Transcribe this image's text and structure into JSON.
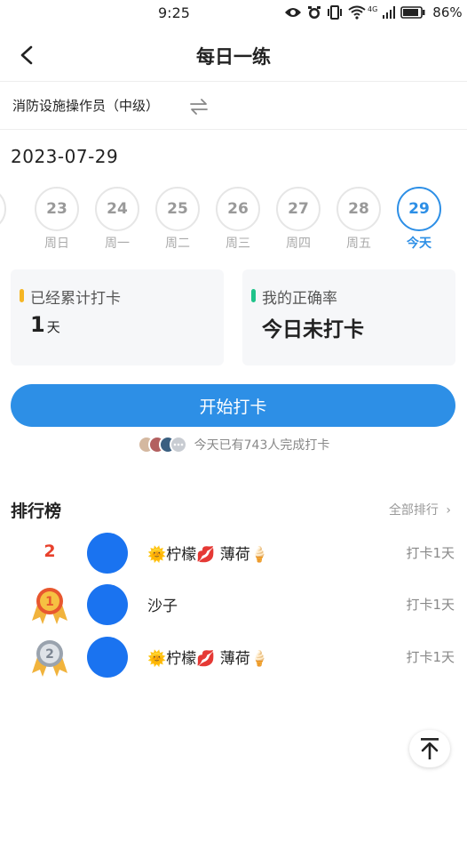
{
  "status": {
    "time": "9:25",
    "network": "4G",
    "battery": "86%"
  },
  "header": {
    "title": "每日一练"
  },
  "course": {
    "name": "消防设施操作员（中级）"
  },
  "date": "2023-07-29",
  "week": [
    {
      "num": "23",
      "label": "周日"
    },
    {
      "num": "24",
      "label": "周一"
    },
    {
      "num": "25",
      "label": "周二"
    },
    {
      "num": "26",
      "label": "周三"
    },
    {
      "num": "27",
      "label": "周四"
    },
    {
      "num": "28",
      "label": "周五"
    },
    {
      "num": "29",
      "label": "今天",
      "active": true
    }
  ],
  "stats": {
    "checkin_label": "已经累计打卡",
    "checkin_value": "1",
    "checkin_unit": "天",
    "accuracy_label": "我的正确率",
    "accuracy_value": "今日未打卡"
  },
  "start_button": "开始打卡",
  "completed_text": "今天已有743人完成打卡",
  "ranking": {
    "title": "排行榜",
    "all_label": "全部排行",
    "rows": [
      {
        "rank": "2",
        "medal": "",
        "name": "🌞柠檬💋 薄荷🍦",
        "days": "打卡1天"
      },
      {
        "rank": "1",
        "medal": "gold-medal-icon",
        "name": "沙子",
        "days": "打卡1天"
      },
      {
        "rank": "2",
        "medal": "silver-medal-icon",
        "name": "🌞柠檬💋 薄荷🍦",
        "days": "打卡1天"
      }
    ]
  },
  "colors": {
    "accent": "#2d8fe6",
    "avatar": "#1a73f0",
    "rank_red": "#e8412c",
    "bar_yellow": "#f5b625",
    "bar_green": "#1fc38a"
  }
}
